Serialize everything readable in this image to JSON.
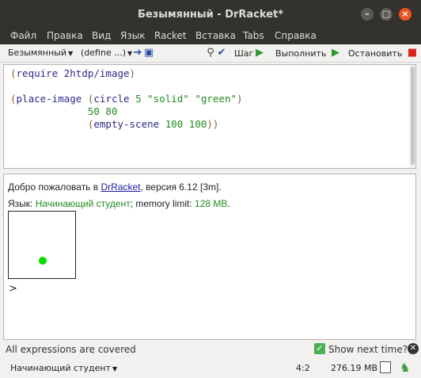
{
  "window": {
    "title": "Безымянный - DrRacket*"
  },
  "menubar": {
    "items": [
      "Файл",
      "Правка",
      "Вид",
      "Язык",
      "Racket",
      "Вставка",
      "Tabs",
      "Справка"
    ]
  },
  "toolbar": {
    "file_name": "Безымянный",
    "define_menu": "(define ...)",
    "step_label": "Шаг",
    "run_label": "Выполнить",
    "stop_label": "Остановить"
  },
  "editor": {
    "lines": [
      "(require 2htdp/image)",
      "",
      "(place-image (circle 5 \"solid\" \"green\")",
      "             50 80",
      "             (empty-scene 100 100))"
    ]
  },
  "interactions": {
    "welcome_prefix": "Добро пожаловать в ",
    "welcome_link": "DrRacket",
    "welcome_suffix": ", версия 6.12 [3m].",
    "lang_prefix": "Язык: ",
    "lang_name": "Начинающий студент",
    "mem_prefix": "; memory limit: ",
    "mem_value": "128 MB",
    "mem_suffix": ".",
    "prompt": ">",
    "scene_dot_color": "#00e000"
  },
  "status": {
    "coverage": "All expressions are covered",
    "show_next_time": "Show next time?",
    "language": "Начинающий студент",
    "position": "4:2",
    "memory": "276.19 MB"
  }
}
